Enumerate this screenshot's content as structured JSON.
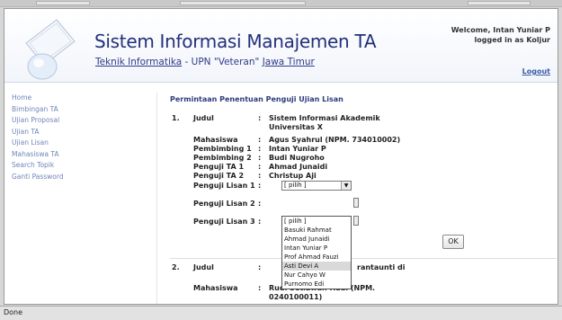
{
  "header": {
    "title": "Sistem Informasi Manajemen TA",
    "subtitle_dept": "Teknik Informatika",
    "subtitle_mid": " - UPN \"Veteran\" ",
    "subtitle_region": "Jawa Timur",
    "welcome_line1": "Welcome, Intan Yuniar P",
    "welcome_line2": "logged in as Koljur",
    "logout": "Logout"
  },
  "sidebar": {
    "items": [
      {
        "label": "Home"
      },
      {
        "label": "Bimbingan TA"
      },
      {
        "label": "Ujian Proposal"
      },
      {
        "label": "Ujian TA"
      },
      {
        "label": "Ujian Lisan"
      },
      {
        "label": "Mahasiswa TA"
      },
      {
        "label": "Search Topik"
      },
      {
        "label": "Ganti Password"
      }
    ]
  },
  "main": {
    "title": "Permintaan Penentuan Penguji Ujian Lisan",
    "record1": {
      "num": "1.",
      "judul_label": "Judul",
      "judul_value": "Sistem Informasi Akademik Universitas X",
      "mahasiswa_label": "Mahasiswa",
      "mahasiswa_value": "Agus Syahrul (NPM. 734010002)",
      "pembimbing1_label": "Pembimbing 1",
      "pembimbing1_value": "Intan Yuniar P",
      "pembimbing2_label": "Pembimbing 2",
      "pembimbing2_value": "Budi Nugroho",
      "pengujita1_label": "Penguji TA 1",
      "pengujita1_value": "Ahmad Junaidi",
      "pengujita2_label": "Penguji TA 2",
      "pengujita2_value": "Christup Aji",
      "lisan1_label": "Penguji Lisan 1",
      "lisan1_selected": "[ pilih ]",
      "lisan2_label": "Penguji Lisan 2",
      "lisan3_label": "Penguji Lisan 3"
    },
    "dropdown_options": [
      "[ pilih ]",
      "Basuki Rahmat",
      "Ahmad Junaidi",
      "Intan Yuniar P",
      "Prof Ahmad Fauzi",
      "Asti Devi A",
      "Nur Cahyo W",
      "Purnomo Edi"
    ],
    "dropdown_highlight_index": 5,
    "ok_label": "OK",
    "record2": {
      "num": "2.",
      "judul_label": "Judul",
      "judul_value_tail": "rantaunti di",
      "mahasiswa_label": "Mahasiswa",
      "mahasiswa_value": "Rudi Setiawan Hadi (NPM. 0240100011)"
    }
  },
  "statusbar": {
    "text": "Done"
  },
  "colors": {
    "title": "#23307a",
    "link": "#6f86b8",
    "accent": "#2d3c7a"
  }
}
